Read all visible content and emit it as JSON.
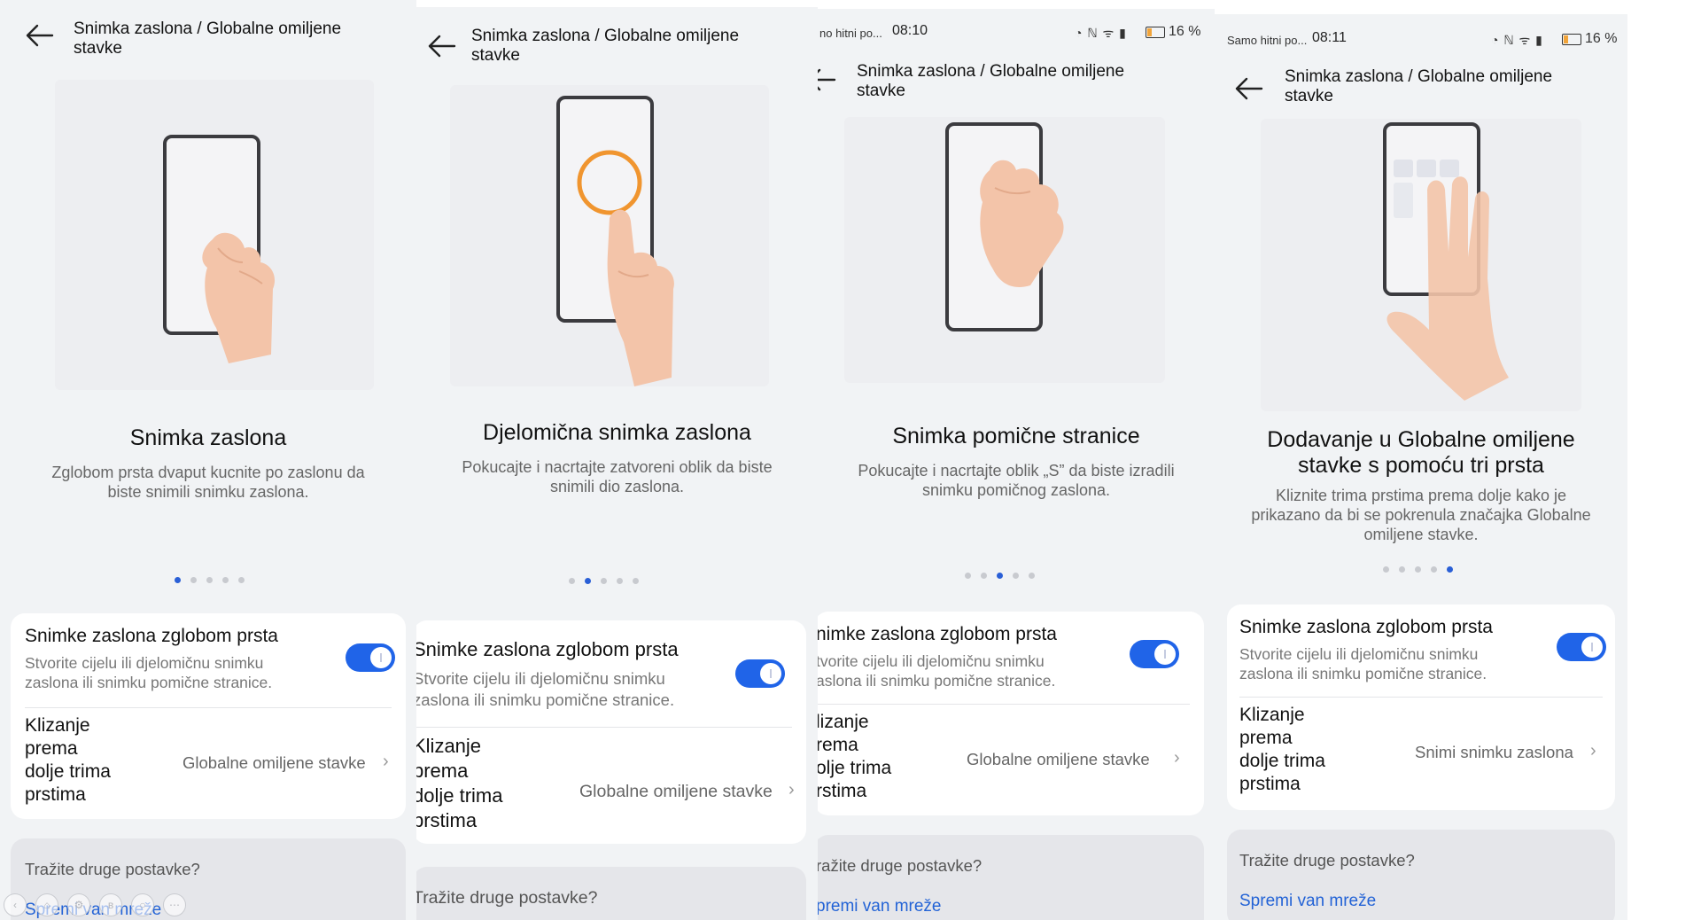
{
  "colors": {
    "accent": "#2064e8",
    "link": "#2363d6",
    "panel_bg": "#f1f3f5",
    "card_bg": "#ffffff",
    "other_card_bg": "#e5e6ea",
    "dot_inactive": "#c8cacf",
    "dot_active": "#2a5fd6",
    "lasso_stroke": "#f0952f",
    "battery_low": "#f1a43a"
  },
  "header_title_line1": "Snimka zaslona / Globalne omiljene",
  "header_title_line2": "stavke",
  "row1": {
    "title": "Snimke zaslona zglobom prsta",
    "desc_line1": "Stvorite cijelu ili djelomičnu snimku",
    "desc_line2": "zaslona ili snimku pomične stranice."
  },
  "row2_lines": [
    "Klizanje",
    "prema",
    "dolje trima",
    "prstima"
  ],
  "other": {
    "question": "Tražite druge postavke?",
    "link": "Spremi van mreže"
  },
  "floating_toolbar_icons": [
    "back-icon",
    "home-icon",
    "settings-icon",
    "bluetooth-icon",
    "search-icon",
    "more-icon"
  ],
  "panels": [
    {
      "card_title": "Snimka zaslona",
      "desc_line1": "Zglobom prsta dvaput kucnite po zaslonu da",
      "desc_line2": "biste snimili snimku zaslona.",
      "active_dot": 0,
      "row2_value": "Globalne omiljene stavke"
    },
    {
      "card_title": "Djelomična snimka zaslona",
      "desc_line1": "Pokucajte i nacrtajte zatvoreni oblik da biste",
      "desc_line2": "snimili dio zaslona.",
      "active_dot": 1,
      "row2_value": "Globalne omiljene stavke"
    },
    {
      "status": {
        "carrier": "no hitni po...",
        "time": "08:10",
        "battery": "16 %"
      },
      "card_title": "Snimka pomične stranice",
      "desc_line1": "Pokucajte i nacrtajte oblik „S” da biste izradili",
      "desc_line2": "snimku pomičnog zaslona.",
      "active_dot": 2,
      "row1_title": "nimke zaslona zglobom prsta",
      "row1_desc_line1": "tvorite cijelu ili djelomičnu snimku",
      "row1_desc_line2": "aslona ili snimku pomične stranice.",
      "row2_lines": [
        "lizanje",
        "rema",
        "olje trima",
        "rstima"
      ],
      "row2_value": "Globalne omiljene stavke",
      "other_question": "ražite druge postavke?",
      "other_link": "premi van mreže"
    },
    {
      "status": {
        "carrier": "Samo hitni po...",
        "time": "08:11",
        "battery": "16 %"
      },
      "card_title_line1": "Dodavanje u Globalne omiljene",
      "card_title_line2": "stavke s pomoću tri prsta",
      "desc_line1": "Kliznite trima prstima prema dolje kako je",
      "desc_line2": "prikazano da bi se pokrenula značajka Globalne",
      "desc_line3": "omiljene stavke.",
      "active_dot": 4,
      "row2_value": "Snimi snimku zaslona"
    }
  ],
  "panel2_row1_title": "Snimke zaslona zglobom prsta",
  "panel2_row1_desc_line1": "Stvorite cijelu ili djelomičnu snimku",
  "panel2_row1_desc_line2": "zaslona ili snimku pomične stranice.",
  "panel2_row2_lines": [
    "Klizanje",
    "prema",
    "dolje trima",
    "prstima"
  ],
  "panel2_other_question": "Tražite druge postavke?"
}
